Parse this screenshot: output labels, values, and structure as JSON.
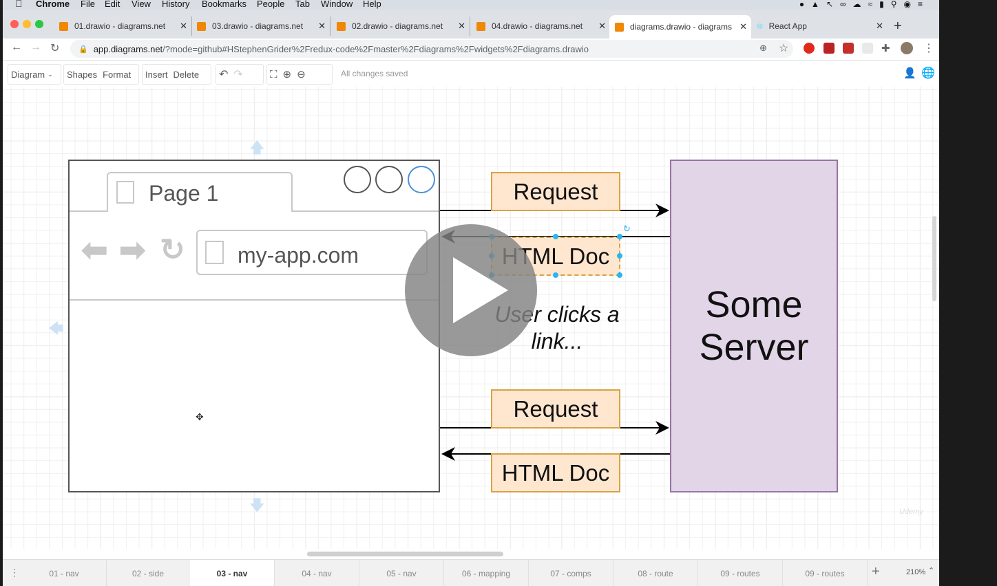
{
  "mac_menu": {
    "app": "Chrome",
    "items": [
      "File",
      "Edit",
      "View",
      "History",
      "Bookmarks",
      "People",
      "Tab",
      "Window",
      "Help"
    ]
  },
  "browser": {
    "tabs": [
      {
        "title": "01.drawio - diagrams.net"
      },
      {
        "title": "03.drawio - diagrams.net"
      },
      {
        "title": "02.drawio - diagrams.net"
      },
      {
        "title": "04.drawio - diagrams.net"
      },
      {
        "title": "diagrams.drawio - diagrams.net"
      },
      {
        "title": "React App"
      }
    ],
    "url_host": "app.diagrams.net",
    "url_path": "/?mode=github#HStephenGrider%2Fredux-code%2Fmaster%2Fdiagrams%2Fwidgets%2Fdiagrams.drawio"
  },
  "toolbar": {
    "diagram_menu": "Diagram",
    "shapes": "Shapes",
    "format": "Format",
    "insert": "Insert",
    "delete": "Delete",
    "status": "All changes saved"
  },
  "diagram": {
    "page_tab_label": "Page 1",
    "address": "my-app.com",
    "request_1": "Request",
    "html_doc_1": "HTML Doc",
    "note": "User clicks a link...",
    "request_2": "Request",
    "html_doc_2": "HTML Doc",
    "server": "Some Server"
  },
  "watermark": "Udemy",
  "page_tabs": [
    "01 - nav",
    "02 - side",
    "03 - nav",
    "04 - nav",
    "05 - nav",
    "06 - mapping",
    "07 - comps",
    "08 - route",
    "09 - routes",
    "09 - routes"
  ],
  "active_page_tab": "03 - nav",
  "zoom": "210%"
}
